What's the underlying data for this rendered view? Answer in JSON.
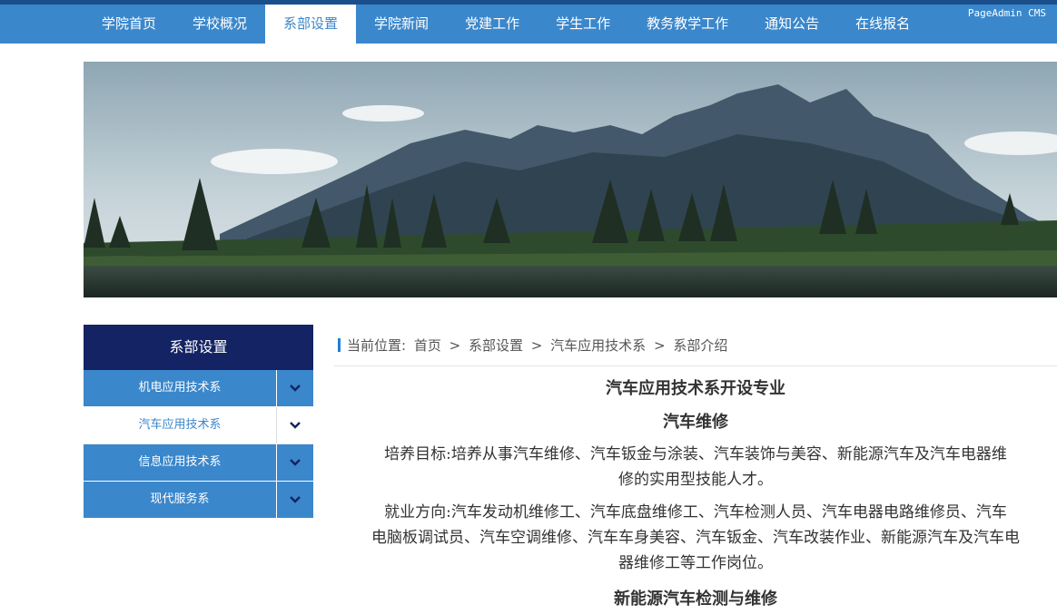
{
  "nav": {
    "items": [
      {
        "label": "学院首页"
      },
      {
        "label": "学校概况"
      },
      {
        "label": "系部设置"
      },
      {
        "label": "学院新闻"
      },
      {
        "label": "党建工作"
      },
      {
        "label": "学生工作"
      },
      {
        "label": "教务教学工作"
      },
      {
        "label": "通知公告"
      },
      {
        "label": "在线报名"
      }
    ],
    "active_label": "系部设置",
    "cms_label": "PageAdmin CMS"
  },
  "sidebar": {
    "title": "系部设置",
    "items": [
      {
        "label": "机电应用技术系",
        "icon": "chevron-down-icon"
      },
      {
        "label": "汽车应用技术系",
        "icon": "chevron-down-icon"
      },
      {
        "label": "信息应用技术系",
        "icon": "chevron-down-icon"
      },
      {
        "label": "现代服务系",
        "icon": "chevron-down-icon"
      }
    ],
    "active_label": "汽车应用技术系"
  },
  "breadcrumb": {
    "prefix": "当前位置:",
    "items": [
      "首页",
      "系部设置",
      "汽车应用技术系",
      "系部介绍"
    ],
    "separator": ">"
  },
  "article": {
    "title": "汽车应用技术系开设专业",
    "section1_title": "汽车维修",
    "section1_goal_line1": "培养目标:培养从事汽车维修、汽车钣金与涂装、汽车装饰与美容、新能源汽车及汽车电器维",
    "section1_goal_line2": "修的实用型技能人才。",
    "section1_job_line1": "就业方向:汽车发动机维修工、汽车底盘维修工、汽车检测人员、汽车电器电路维修员、汽车",
    "section1_job_line2": "电脑板调试员、汽车空调维修、汽车车身美容、汽车钣金、汽车改装作业、新能源汽车及汽车电",
    "section1_job_line3": "器维修工等工作岗位。",
    "section2_title": "新能源汽车检测与维修"
  },
  "colors": {
    "nav_blue": "#3b87cb",
    "sidebar_title_navy": "#132363",
    "breadcrumb_mark": "#1e7fd6"
  }
}
